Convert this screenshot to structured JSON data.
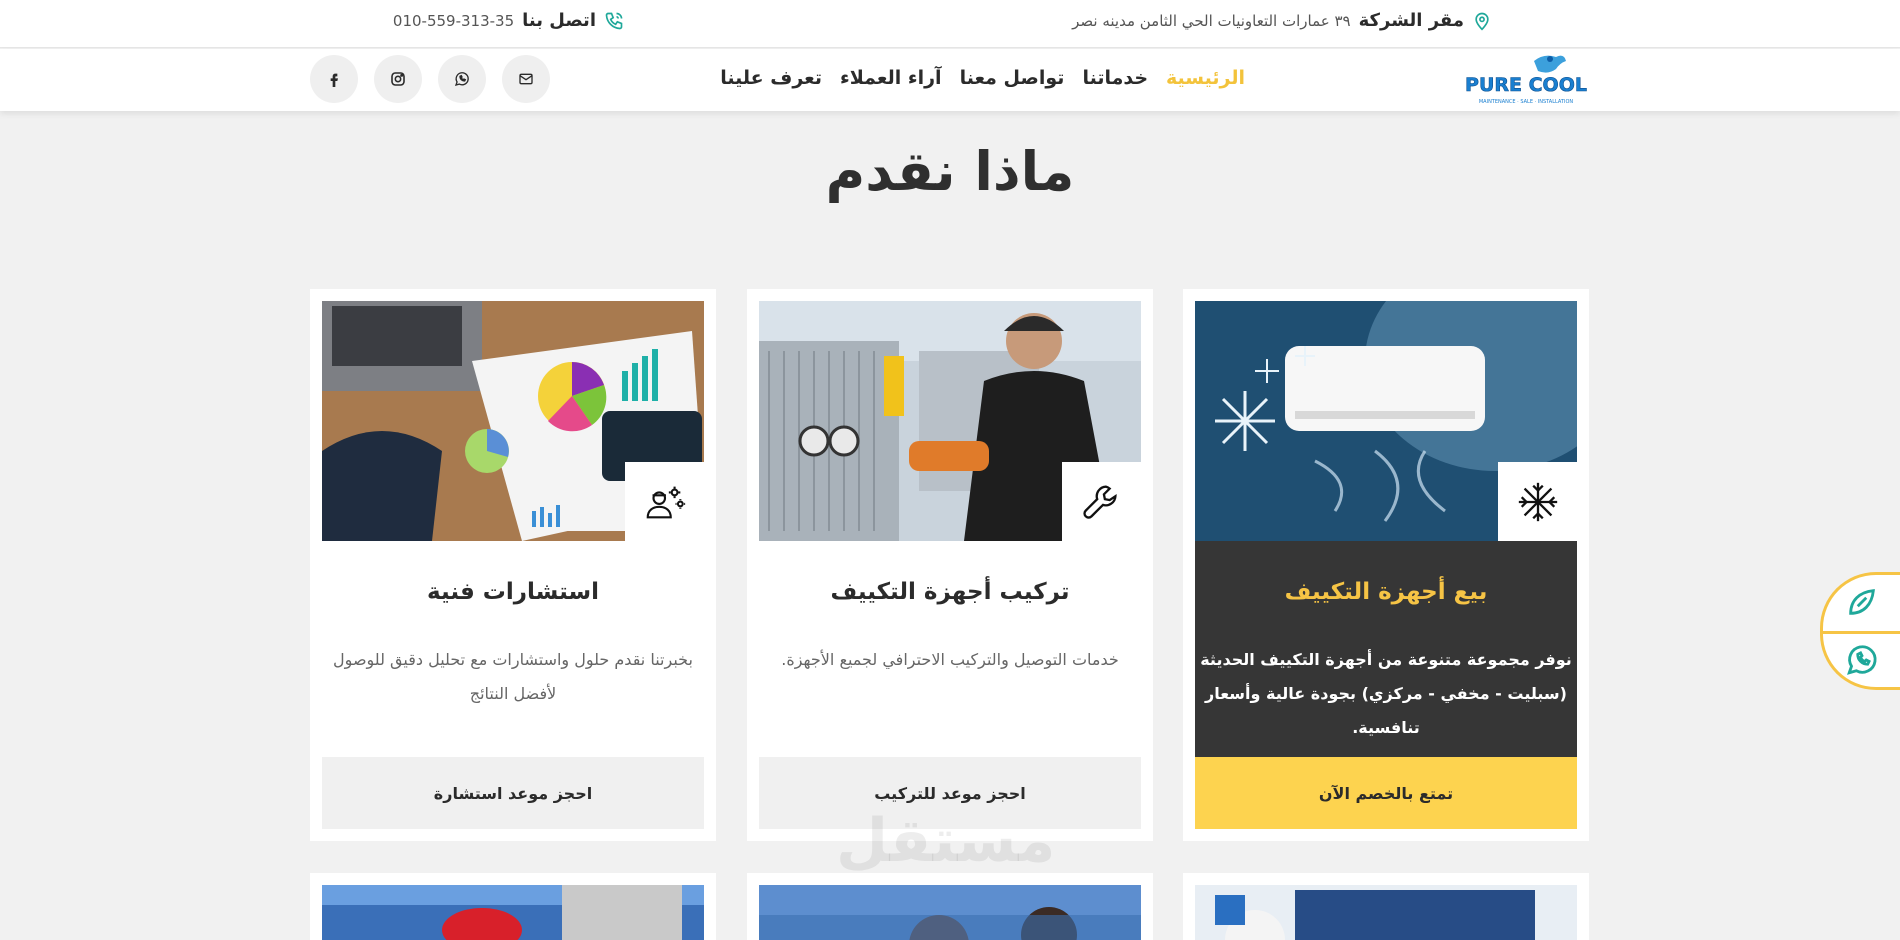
{
  "topbar": {
    "address_label": "مقر الشركة",
    "address_value": "٣٩ عمارات التعاونيات الحي الثامن مدينه نصر",
    "phone_label": "اتصل بنا",
    "phone_value": "010-559-313-35"
  },
  "logo": {
    "line1": "PURE COOL",
    "tagline": "MAINTENANCE · SALE · INSTALLATION"
  },
  "nav": {
    "items": [
      {
        "label": "الرئيسية",
        "active": true
      },
      {
        "label": "خدماتنا"
      },
      {
        "label": "تواصل معنا"
      },
      {
        "label": "آراء العملاء"
      },
      {
        "label": "تعرف علينا"
      }
    ]
  },
  "socials": [
    "facebook-icon",
    "instagram-icon",
    "whatsapp-icon",
    "mail-icon"
  ],
  "section": {
    "title": "ماذا نقدم"
  },
  "cards": [
    {
      "title": "بيع أجهزة التكييف",
      "description": "نوفر مجموعة متنوعة من أجهزة التكييف الحديثة (سبليت - مخفي - مركزي) بجودة عالية وأسعار تنافسية.",
      "button": "تمتع بالخصم الآن",
      "icon": "snowflake-icon",
      "featured": true
    },
    {
      "title": "تركيب أجهزة التكييف",
      "description": "خدمات التوصيل والتركيب الاحترافي لجميع الأجهزة.",
      "button": "احجز موعد للتركيب",
      "icon": "wrench-icon"
    },
    {
      "title": "استشارات فنية",
      "description": "بخبرتنا نقدم حلول واستشارات مع تحليل دقيق للوصول لأفضل النتائج",
      "button": "احجز موعد استشارة",
      "icon": "technician-gear-icon"
    }
  ],
  "watermark": "مستقل",
  "colors": {
    "accent": "#f6c445",
    "dark": "#363636",
    "teal": "#1fa89a"
  }
}
